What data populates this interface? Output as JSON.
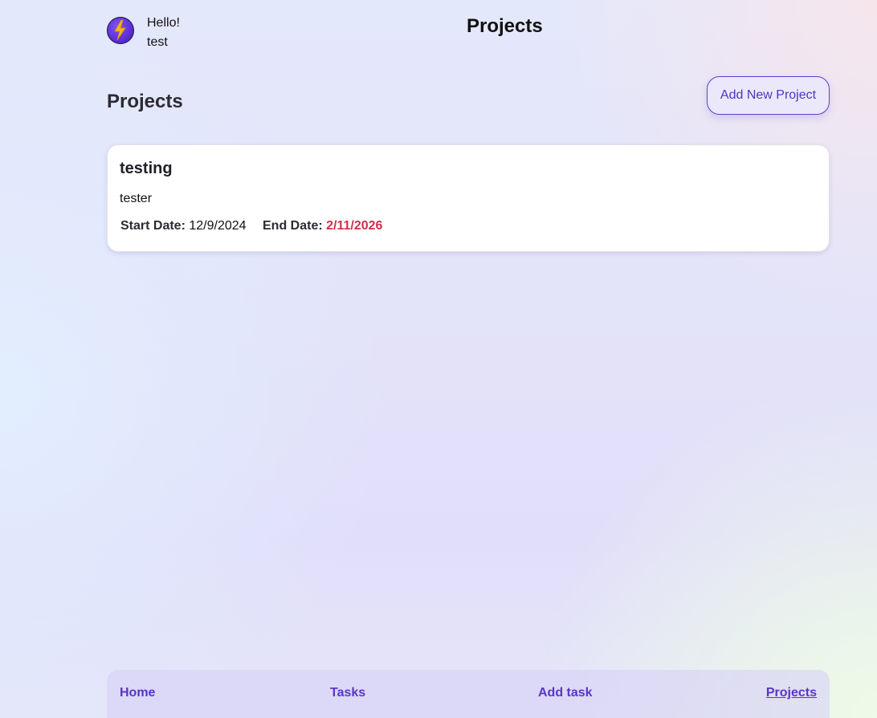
{
  "header": {
    "greeting": "Hello!",
    "username": "test",
    "title": "Projects",
    "avatar_icon": "lightning-bolt-icon"
  },
  "main": {
    "section_title": "Projects",
    "add_button_label": "Add New Project",
    "projects": [
      {
        "name": "testing",
        "description": "tester",
        "start_label": "Start Date:",
        "start_date": "12/9/2024",
        "end_label": "End Date:",
        "end_date": "2/11/2026",
        "end_date_color": "#d0304a"
      }
    ]
  },
  "nav": {
    "items": [
      {
        "label": "Home",
        "active": false
      },
      {
        "label": "Tasks",
        "active": false
      },
      {
        "label": "Add task",
        "active": false
      },
      {
        "label": "Projects",
        "active": true
      }
    ]
  },
  "colors": {
    "accent": "#5a35c8",
    "overdue": "#d0304a"
  }
}
